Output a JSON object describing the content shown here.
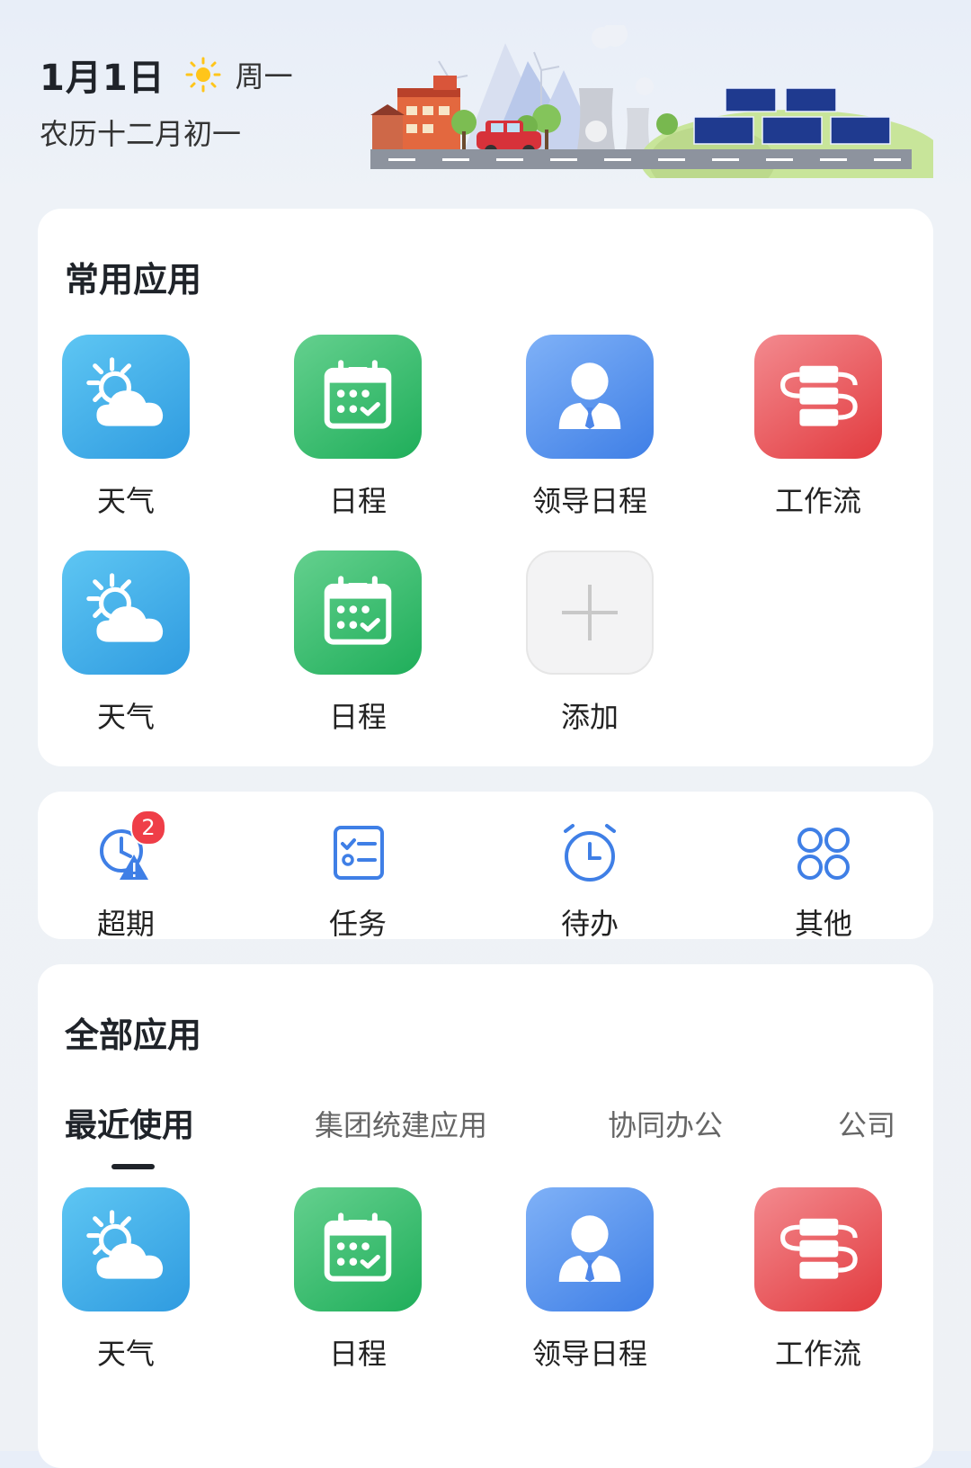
{
  "header": {
    "date": "1月1日",
    "weekday": "周一",
    "lunar": "农历十二月初一"
  },
  "common_apps": {
    "title": "常用应用",
    "items": [
      {
        "label": "天气",
        "icon": "weather-icon"
      },
      {
        "label": "日程",
        "icon": "calendar-icon"
      },
      {
        "label": "领导日程",
        "icon": "leader-icon"
      },
      {
        "label": "工作流",
        "icon": "workflow-icon"
      },
      {
        "label": "天气",
        "icon": "weather-icon"
      },
      {
        "label": "日程",
        "icon": "calendar-icon"
      },
      {
        "label": "添加",
        "icon": "plus-icon"
      }
    ]
  },
  "quick": {
    "items": [
      {
        "label": "超期",
        "icon": "overdue-clock-icon",
        "badge": "2"
      },
      {
        "label": "任务",
        "icon": "task-checklist-icon"
      },
      {
        "label": "待办",
        "icon": "alarm-clock-icon"
      },
      {
        "label": "其他",
        "icon": "grid-other-icon"
      }
    ]
  },
  "all_apps": {
    "title": "全部应用",
    "tabs": [
      "最近使用",
      "集团统建应用",
      "协同办公",
      "公司"
    ],
    "items": [
      {
        "label": "天气",
        "icon": "weather-icon"
      },
      {
        "label": "日程",
        "icon": "calendar-icon"
      },
      {
        "label": "领导日程",
        "icon": "leader-icon"
      },
      {
        "label": "工作流",
        "icon": "workflow-icon"
      }
    ]
  },
  "colors": {
    "accent_blue": "#3f7fe6",
    "badge_red": "#ef3e48",
    "weather_blue": "#2f9be0",
    "schedule_green": "#1fae5a",
    "workflow_red": "#e23b3f"
  }
}
